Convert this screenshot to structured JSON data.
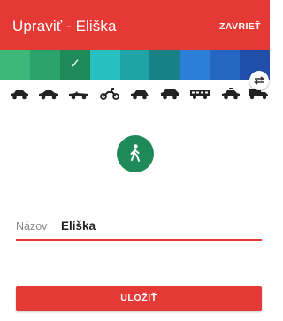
{
  "appbar": {
    "title": "Upraviť - Eliška",
    "close_label": "ZAVRIEŤ",
    "color": "#e53935"
  },
  "color_palette": {
    "swatches": [
      "#3cb878",
      "#2aa46b",
      "#1e8a57",
      "#26c0c0",
      "#1fa3a6",
      "#178184",
      "#2c7ed6",
      "#2566c2",
      "#1f4fa8"
    ],
    "selected_index": 2,
    "check_glyph": "✓"
  },
  "vehicles": {
    "items": [
      "car-icon",
      "sedan-icon",
      "convertible-icon",
      "motorcycle-icon",
      "hatchback-icon",
      "suv-icon",
      "bus-icon",
      "police-car-icon",
      "truck-icon"
    ],
    "swap_icon": "swap-icon"
  },
  "mode": {
    "icon": "walking-person-icon",
    "color": "#1e8a57"
  },
  "form": {
    "name_label": "Názov",
    "name_value": "Eliška"
  },
  "actions": {
    "save_label": "ULOŽIŤ"
  }
}
